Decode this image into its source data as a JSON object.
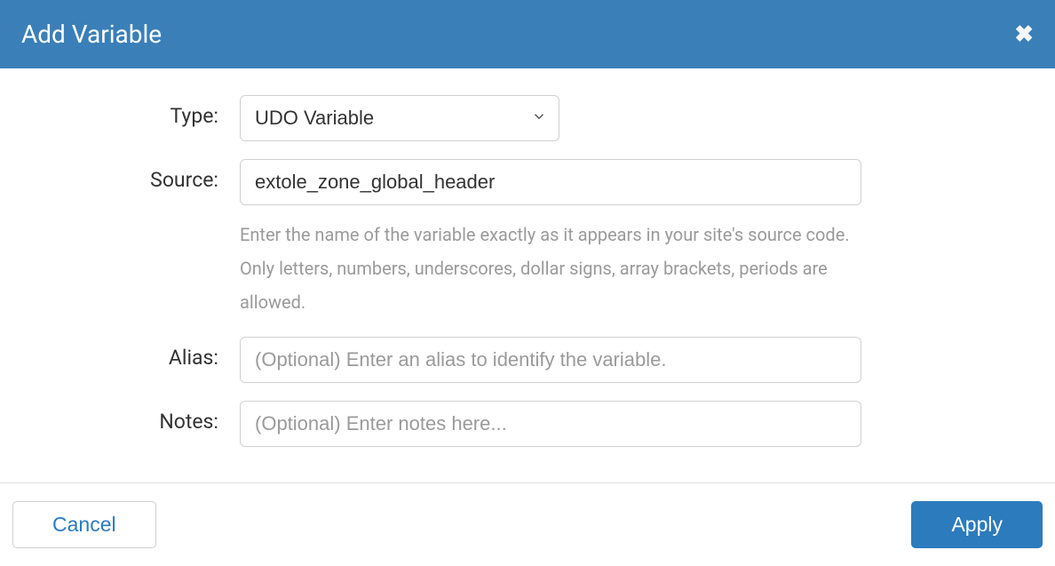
{
  "header": {
    "title": "Add Variable"
  },
  "form": {
    "type": {
      "label": "Type:",
      "value": "UDO Variable"
    },
    "source": {
      "label": "Source:",
      "value": "extole_zone_global_header",
      "help": "Enter the name of the variable exactly as it appears in your site's source code. Only letters, numbers, underscores, dollar signs, array brackets, periods are allowed."
    },
    "alias": {
      "label": "Alias:",
      "value": "",
      "placeholder": "(Optional) Enter an alias to identify the variable."
    },
    "notes": {
      "label": "Notes:",
      "value": "",
      "placeholder": "(Optional) Enter notes here..."
    }
  },
  "footer": {
    "cancel_label": "Cancel",
    "apply_label": "Apply"
  }
}
